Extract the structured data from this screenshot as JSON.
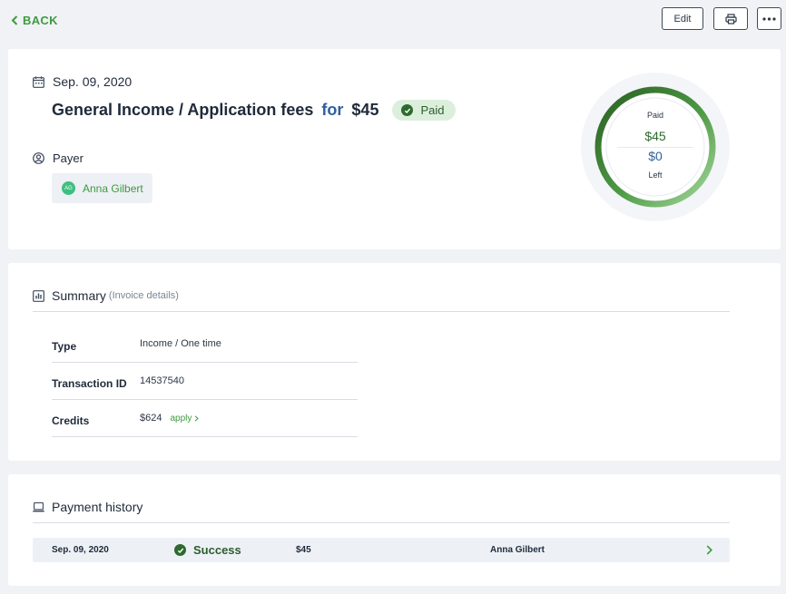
{
  "topbar": {
    "back_label": "BACK",
    "edit_label": "Edit"
  },
  "transaction": {
    "date": "Sep. 09, 2020",
    "title": "General Income / Application fees",
    "for_word": "for",
    "amount": "$45",
    "status": "Paid"
  },
  "payer": {
    "label": "Payer",
    "initials": "AG",
    "name": "Anna Gilbert"
  },
  "ring": {
    "paid_label": "Paid",
    "paid_amount": "$45",
    "left_amount": "$0",
    "left_label": "Left",
    "paid_fraction": 1.0
  },
  "summary": {
    "title": "Summary",
    "subtitle": "(Invoice details)",
    "rows": [
      {
        "key": "Type",
        "value": "Income / One time"
      },
      {
        "key": "Transaction ID",
        "value": "14537540"
      },
      {
        "key": "Credits",
        "value": "$624",
        "action": "apply"
      }
    ]
  },
  "payment_history": {
    "title": "Payment history",
    "rows": [
      {
        "date": "Sep. 09, 2020",
        "status": "Success",
        "amount": "$45",
        "payer": "Anna Gilbert"
      }
    ]
  },
  "colors": {
    "accent_green": "#3f9a3f",
    "dark_green": "#2d6a2d",
    "blue": "#2f5fa0",
    "background": "#f0f2f6"
  }
}
